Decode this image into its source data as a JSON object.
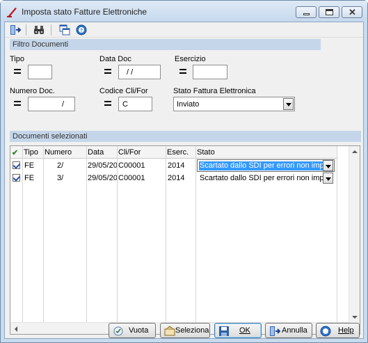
{
  "window": {
    "title": "Imposta stato Fatture Elettroniche"
  },
  "icons": [
    "exit-icon",
    "binoculars-icon",
    "windows-icon",
    "help-icon"
  ],
  "filtro": {
    "header": "Filtro Documenti",
    "tipo_label": "Tipo",
    "tipo_value": "",
    "datadoc_label": "Data Doc",
    "datadoc_value": "/ /",
    "esercizio_label": "Esercizio",
    "esercizio_value": "",
    "numero_label": "Numero Doc.",
    "numero_value": "/",
    "codice_label": "Codice Cli/For",
    "codice_value": "C",
    "stato_label": "Stato Fattura Elettronica",
    "stato_value": "Inviato"
  },
  "documenti": {
    "header": "Documenti selezionati",
    "columns": [
      "✔",
      "Tipo",
      "Numero",
      "Data",
      "Cli/For",
      "Eserc.",
      "Stato"
    ],
    "rows": [
      {
        "checked": true,
        "tipo": "FE",
        "numero": "2/",
        "data": "29/05/20",
        "clifor": "C00001",
        "eserc": "2014",
        "stato": "Scartato dallo SDI per errori non impu"
      },
      {
        "checked": true,
        "tipo": "FE",
        "numero": "3/",
        "data": "29/05/20",
        "clifor": "C00001",
        "eserc": "2014",
        "stato": "Scartato dallo SDI per errori non impu"
      }
    ]
  },
  "buttons": {
    "vuota": "Vuota",
    "seleziona": "Seleziona",
    "ok": "OK",
    "annulla": "Annulla",
    "help": "Help"
  },
  "colors": {
    "group_header": "#c5d6ea",
    "selection": "#3399ff",
    "title_bg": "#c9dcef"
  }
}
